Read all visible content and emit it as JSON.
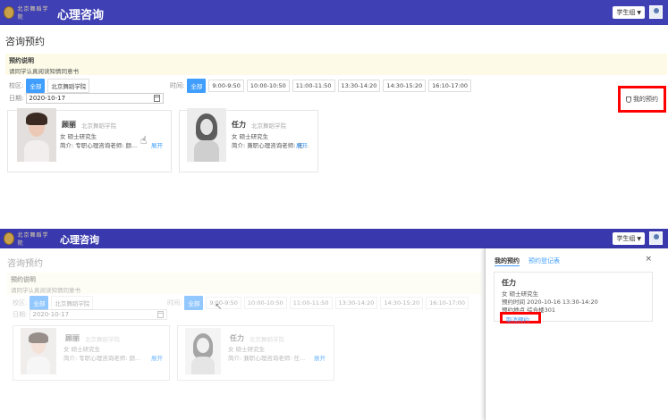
{
  "app": {
    "title": "心理咨询",
    "logo_text": "北京舞蹈学院",
    "user_role": "学生组"
  },
  "page": {
    "title": "咨询预约",
    "notice_title": "预约说明",
    "notice_text": "请同学认真阅读知情同意书"
  },
  "filters": {
    "campus_label": "校区:",
    "campus_options": [
      "全部",
      "北京舞蹈学院"
    ],
    "time_label": "时间:",
    "time_options": [
      "全部",
      "9:00-9:50",
      "10:00-10:50",
      "11:00-11:50",
      "13:30-14:20",
      "14:30-15:20",
      "16:10-17:00"
    ],
    "date_label": "日期:",
    "date_value": "2020-10-17"
  },
  "my_booking_button": "我的预约",
  "counselors": [
    {
      "name": "顾丽",
      "school": "北京舞蹈学院",
      "info": "女 硕士研究生",
      "intro": "简介: 专职心理咨询老师: 颜...",
      "more": "展开"
    },
    {
      "name": "任力",
      "school": "北京舞蹈学院",
      "info": "女 硕士研究生",
      "intro": "简介: 兼职心理咨询老师: 任...",
      "more": "展开"
    }
  ],
  "drawer": {
    "tab_my": "我的预约",
    "tab_register": "预约登记表",
    "close": "×",
    "appointment": {
      "name": "任力",
      "info": "女 硕士研究生",
      "time_label": "预约时间",
      "time_value": "2020-10-16 13:30-14:20",
      "place_label": "预约地点",
      "place_value": "综合楼301",
      "cancel": "取消预约"
    }
  },
  "colors": {
    "topbar": "#3f40b3",
    "accent": "#409eff",
    "highlight": "#ff0000",
    "notice_bg": "#fdfbe7"
  }
}
